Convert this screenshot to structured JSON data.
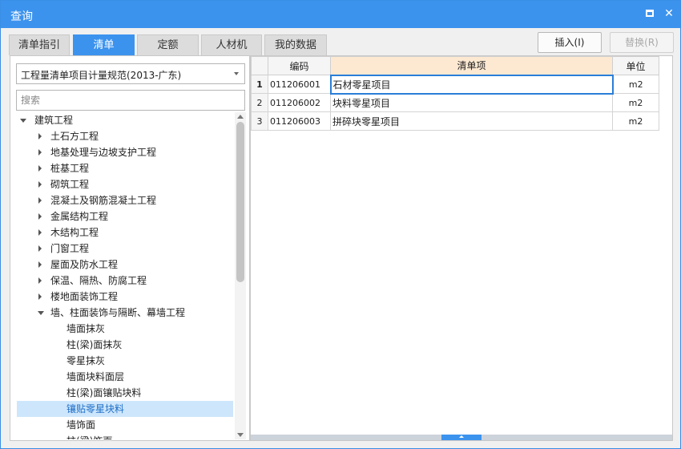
{
  "window": {
    "title": "查询",
    "accent": "#3c93ee"
  },
  "tabs": [
    {
      "label": "清单指引"
    },
    {
      "label": "清单"
    },
    {
      "label": "定额"
    },
    {
      "label": "人材机"
    },
    {
      "label": "我的数据"
    }
  ],
  "active_tab": "清单",
  "actions": {
    "insert_label": "插入(I)",
    "replace_label": "替换(R)"
  },
  "left": {
    "spec_select": "工程量清单项目计量规范(2013-广东)",
    "search_placeholder": "搜索",
    "tree": {
      "root": "建筑工程",
      "items": [
        {
          "label": "土石方工程"
        },
        {
          "label": "地基处理与边坡支护工程"
        },
        {
          "label": "桩基工程"
        },
        {
          "label": "砌筑工程"
        },
        {
          "label": "混凝土及钢筋混凝土工程"
        },
        {
          "label": "金属结构工程"
        },
        {
          "label": "木结构工程"
        },
        {
          "label": "门窗工程"
        },
        {
          "label": "屋面及防水工程"
        },
        {
          "label": "保温、隔热、防腐工程"
        },
        {
          "label": "楼地面装饰工程"
        },
        {
          "label": "墙、柱面装饰与隔断、幕墙工程"
        }
      ],
      "children": [
        {
          "label": "墙面抹灰"
        },
        {
          "label": "柱(梁)面抹灰"
        },
        {
          "label": "零星抹灰"
        },
        {
          "label": "墙面块料面层"
        },
        {
          "label": "柱(梁)面镶贴块料"
        },
        {
          "label": "镶贴零星块料"
        },
        {
          "label": "墙饰面"
        },
        {
          "label": "柱(梁)饰面"
        }
      ],
      "selected": "镶贴零星块料"
    }
  },
  "grid": {
    "headers": {
      "code": "编码",
      "name": "清单项",
      "unit": "单位"
    },
    "rows": [
      {
        "num": "1",
        "code": "011206001",
        "name": "石材零星项目",
        "unit": "m2"
      },
      {
        "num": "2",
        "code": "011206002",
        "name": "块料零星项目",
        "unit": "m2"
      },
      {
        "num": "3",
        "code": "011206003",
        "name": "拼碎块零星项目",
        "unit": "m2"
      }
    ]
  }
}
